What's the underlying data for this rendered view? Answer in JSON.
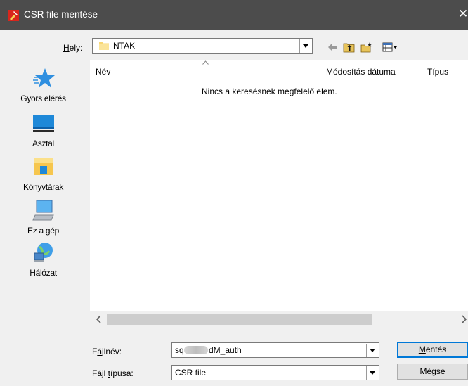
{
  "window": {
    "title": "CSR file mentése"
  },
  "location": {
    "label": "Hely:",
    "value": "NTAK"
  },
  "places": [
    {
      "label": "Gyors elérés",
      "icon": "star-icon"
    },
    {
      "label": "Asztal",
      "icon": "desktop-icon"
    },
    {
      "label": "Könyvtárak",
      "icon": "library-icon"
    },
    {
      "label": "Ez a gép",
      "icon": "computer-icon"
    },
    {
      "label": "Hálózat",
      "icon": "network-icon"
    }
  ],
  "file_list": {
    "columns": [
      "Név",
      "Módosítás dátuma",
      "Típus"
    ],
    "empty_message": "Nincs a keresésnek megfelelő elem."
  },
  "filename": {
    "label": "Fájlnév:",
    "value_prefix": "sq",
    "value_suffix": "dM_auth"
  },
  "filetype": {
    "label": "Fájl típusa:",
    "value": "CSR file"
  },
  "buttons": {
    "save": "Mentés",
    "cancel": "Mégse"
  },
  "colors": {
    "titlebar": "#4c4c4c",
    "accent": "#0078d7",
    "background": "#f0f0f0"
  }
}
